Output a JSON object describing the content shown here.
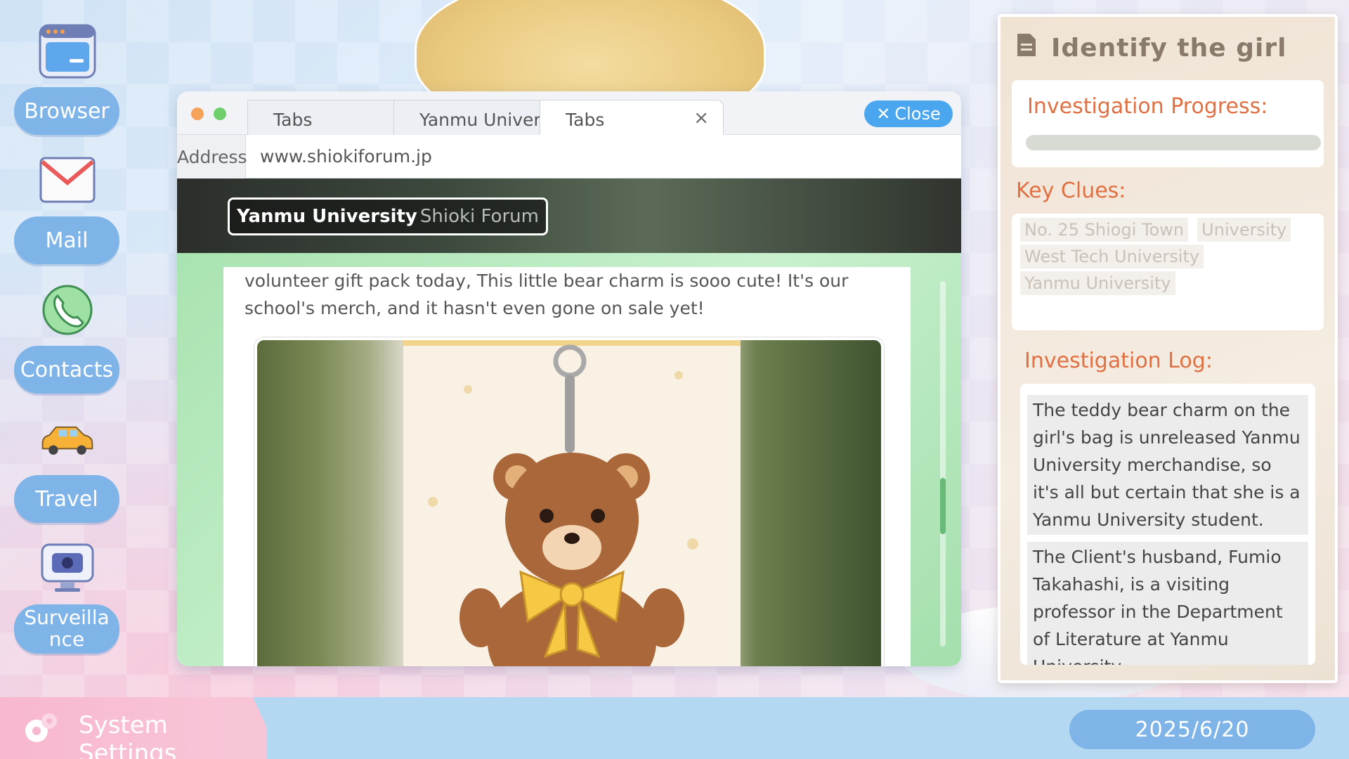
{
  "dock": {
    "items": [
      {
        "label": "Browser",
        "icon": "browser-icon"
      },
      {
        "label": "Mail",
        "icon": "mail-icon"
      },
      {
        "label": "Contacts",
        "icon": "phone-icon"
      },
      {
        "label": "Travel",
        "icon": "car-icon"
      },
      {
        "label": "Surveillance",
        "label_display": "Surveilla\nnce",
        "icon": "camera-monitor-icon"
      }
    ]
  },
  "browser": {
    "tabs": [
      "Tabs",
      "Yanmu Universi",
      "Tabs"
    ],
    "close_label": "Close",
    "address_label": "Address",
    "address_value": "www.shiokiforum.jp",
    "site_logo_main": "Yanmu University",
    "site_logo_sub": "Shioki Forum",
    "post_text": "volunteer gift pack today, This little bear charm is sooo cute! It's our school's merch, and it hasn't even gone on sale yet!",
    "photo_subject": "teddy bear keychain with yellow bow"
  },
  "panel": {
    "title": "Identify the girl",
    "progress_title": "Investigation Progress:",
    "progress_value": 0.0,
    "clues_title": "Key Clues:",
    "clues": [
      "No. 25 Shiogi Town",
      "University",
      "West Tech University",
      "Yanmu University"
    ],
    "log_title": "Investigation Log:",
    "log": [
      "The teddy bear charm on the girl's bag is unreleased Yanmu University merchandise, so it's all but certain that she is a Yanmu University student.",
      "The Client's husband, Fumio Takahashi, is a visiting professor in the Department of Literature at Yanmu University."
    ]
  },
  "bottom": {
    "settings_label": "System Settings",
    "date": "2025/6/20"
  },
  "colors": {
    "accent_blue": "#7fb4e8",
    "accent_orange": "#e07042",
    "close_blue": "#4aa7ef"
  }
}
